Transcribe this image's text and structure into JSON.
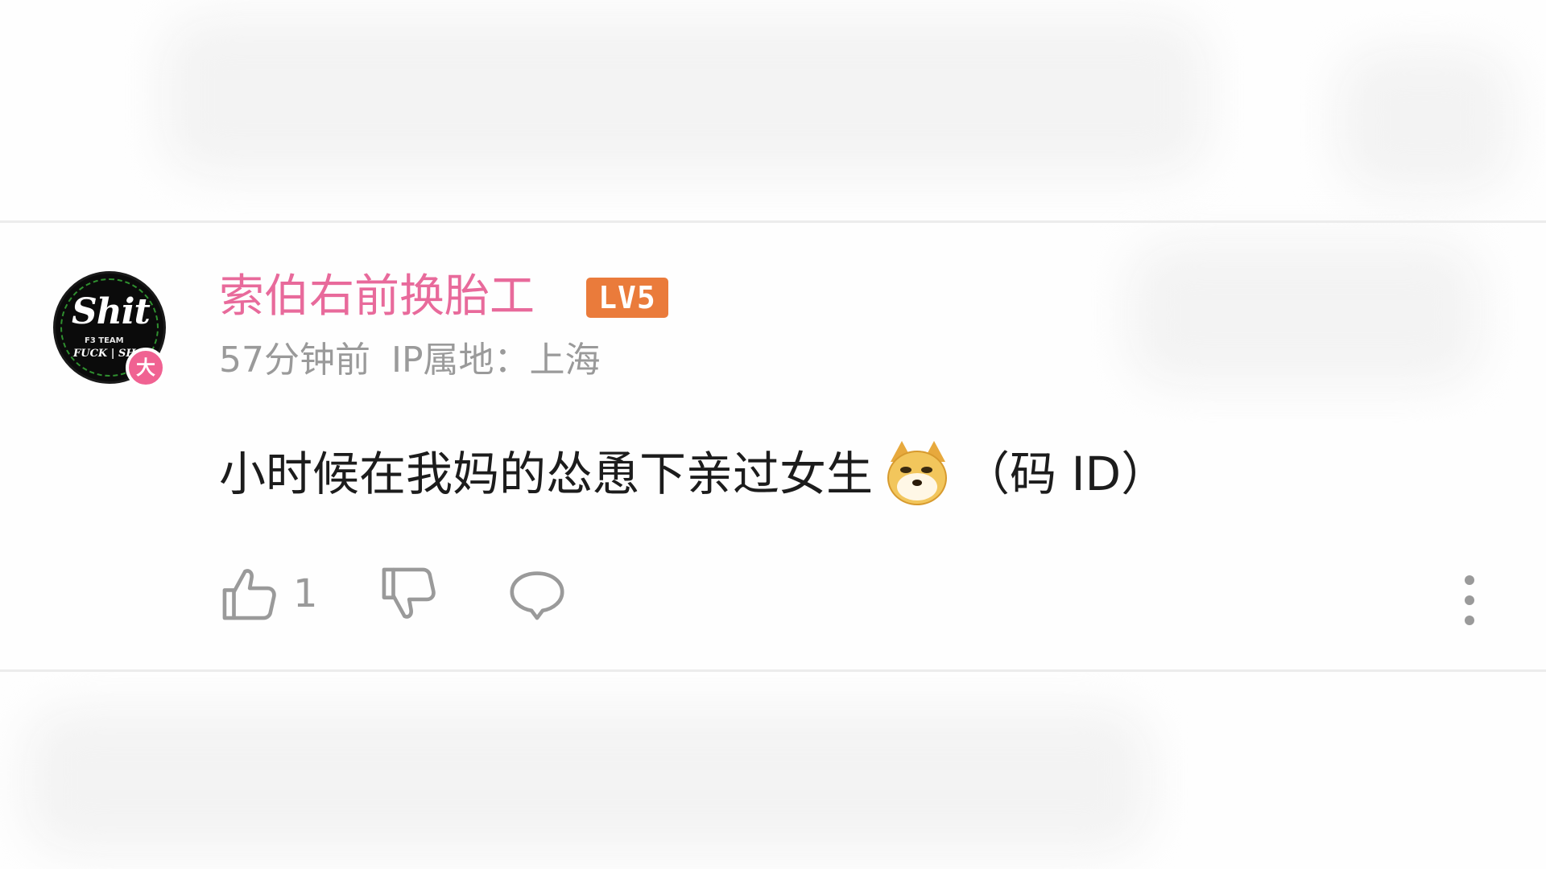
{
  "comment": {
    "username": "索伯右前换胎工",
    "level": "LV5",
    "vip_badge": "大",
    "time": "57分钟前",
    "ip_location": "IP属地：上海",
    "text_before_emoji": "小时候在我妈的怂恿下亲过女生",
    "emoji": "doge-emoji",
    "text_after_emoji": "（码 ID）",
    "like_count": "1",
    "avatar": {
      "title": "Shit",
      "line1": "F3 TEAM",
      "line2": "FUCK | SHA"
    }
  },
  "colors": {
    "username": "#e86a9b",
    "level_badge": "#ea7b3b",
    "meta_text": "#9a9a9a",
    "content_text": "#1c1c1c",
    "icon_gray": "#9a9a9a",
    "vip_badge": "#f06292"
  },
  "icons": {
    "like": "thumbs-up-icon",
    "dislike": "thumbs-down-icon",
    "reply": "comment-bubble-icon",
    "more": "more-vertical-icon"
  }
}
